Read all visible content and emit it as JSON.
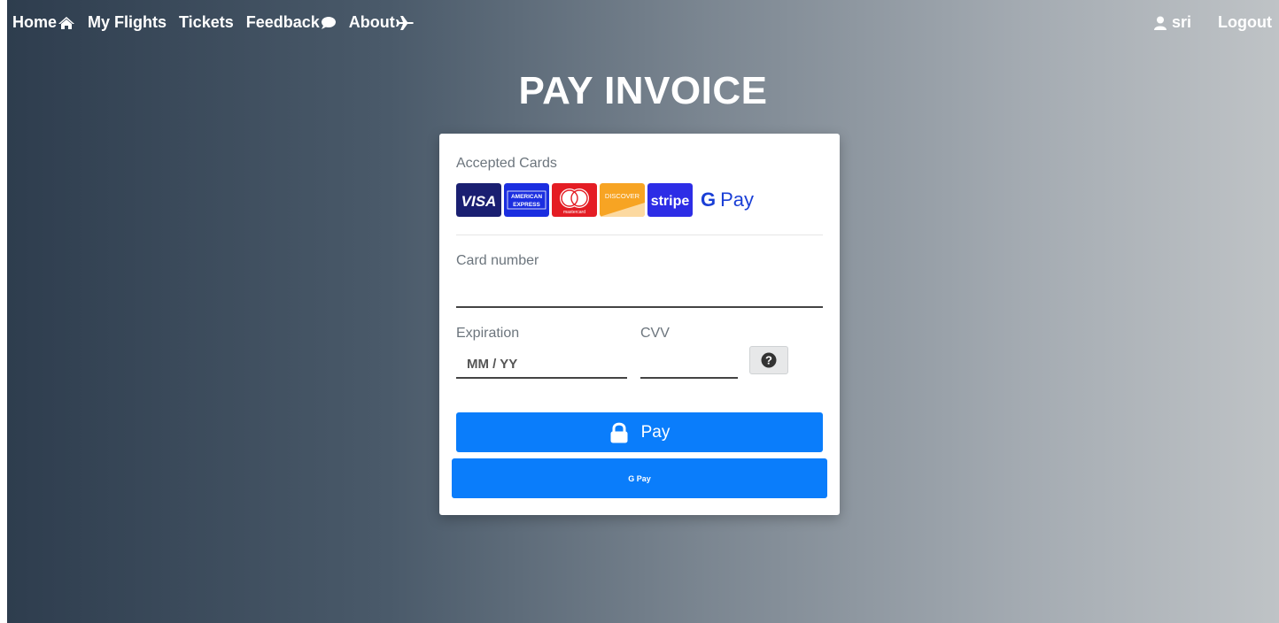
{
  "nav": {
    "home": "Home",
    "my_flights": "My Flights",
    "tickets": "Tickets",
    "feedback": "Feedback",
    "about": "About",
    "user": "sri",
    "logout": "Logout"
  },
  "page_title": "PAY INVOICE",
  "payment": {
    "accepted_cards_label": "Accepted Cards",
    "card_logos": {
      "visa": "VISA",
      "amex": "AMERICAN EXPRESS",
      "mastercard": "mastercard",
      "discover": "DISCOVER",
      "stripe": "stripe",
      "gpay": "Pay"
    },
    "card_number_label": "Card number",
    "card_number_value": "",
    "expiration_label": "Expiration",
    "expiration_placeholder": "MM / YY",
    "cvv_label": "CVV",
    "cvv_value": "",
    "pay_button_label": "Pay",
    "gpay_button_label": "G Pay"
  },
  "colors": {
    "accent": "#0a7dfb",
    "gradient_start": "#2e3d4e",
    "gradient_end": "#bfc3c6"
  }
}
